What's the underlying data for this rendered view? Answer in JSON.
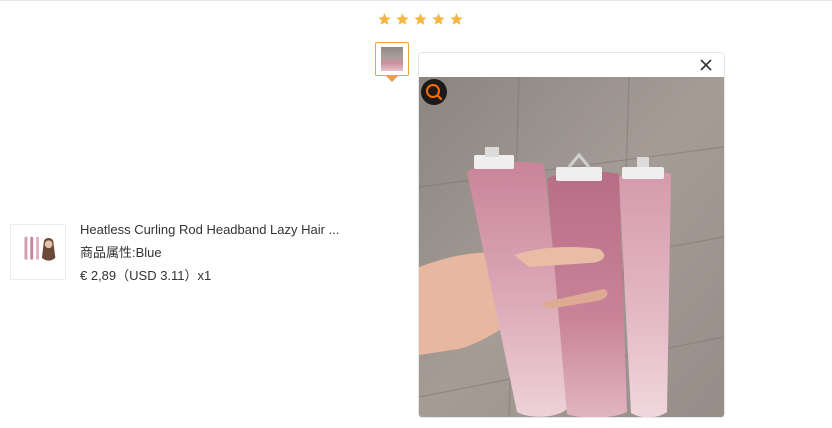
{
  "review": {
    "rating": 5,
    "rating_max": 5,
    "star_color": "#f5a623"
  },
  "product": {
    "title": "Heatless Curling Rod Headband Lazy Hair ...",
    "attr_label": "商品属性:",
    "attr_value": "Blue",
    "price": "€ 2,89（USD  3.11）x1"
  },
  "viewer": {
    "close_icon": "close-icon",
    "zoom_icon": "search-icon"
  },
  "colors": {
    "accent": "#f0a23a",
    "text": "#333333"
  }
}
